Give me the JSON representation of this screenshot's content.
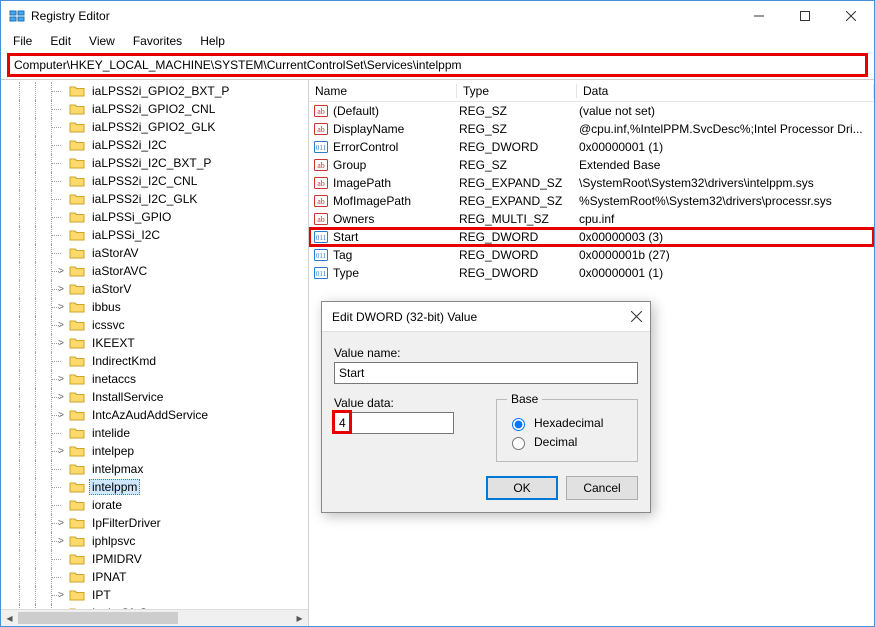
{
  "window": {
    "title": "Registry Editor"
  },
  "menu": {
    "file": "File",
    "edit": "Edit",
    "view": "View",
    "favorites": "Favorites",
    "help": "Help"
  },
  "address": "Computer\\HKEY_LOCAL_MACHINE\\SYSTEM\\CurrentControlSet\\Services\\intelppm",
  "tree": {
    "items": [
      {
        "label": "iaLPSS2i_GPIO2_BXT_P",
        "exp": ""
      },
      {
        "label": "iaLPSS2i_GPIO2_CNL",
        "exp": ""
      },
      {
        "label": "iaLPSS2i_GPIO2_GLK",
        "exp": ""
      },
      {
        "label": "iaLPSS2i_I2C",
        "exp": ""
      },
      {
        "label": "iaLPSS2i_I2C_BXT_P",
        "exp": ""
      },
      {
        "label": "iaLPSS2i_I2C_CNL",
        "exp": ""
      },
      {
        "label": "iaLPSS2i_I2C_GLK",
        "exp": ""
      },
      {
        "label": "iaLPSSi_GPIO",
        "exp": ""
      },
      {
        "label": "iaLPSSi_I2C",
        "exp": ""
      },
      {
        "label": "iaStorAV",
        "exp": ""
      },
      {
        "label": "iaStorAVC",
        "exp": ">"
      },
      {
        "label": "iaStorV",
        "exp": ">"
      },
      {
        "label": "ibbus",
        "exp": ">"
      },
      {
        "label": "icssvc",
        "exp": ">"
      },
      {
        "label": "IKEEXT",
        "exp": ">"
      },
      {
        "label": "IndirectKmd",
        "exp": ""
      },
      {
        "label": "inetaccs",
        "exp": ">"
      },
      {
        "label": "InstallService",
        "exp": ">"
      },
      {
        "label": "IntcAzAudAddService",
        "exp": ">"
      },
      {
        "label": "intelide",
        "exp": ""
      },
      {
        "label": "intelpep",
        "exp": ">"
      },
      {
        "label": "intelpmax",
        "exp": ""
      },
      {
        "label": "intelppm",
        "exp": "",
        "selected": true
      },
      {
        "label": "iorate",
        "exp": ""
      },
      {
        "label": "IpFilterDriver",
        "exp": ">"
      },
      {
        "label": "iphlpsvc",
        "exp": ">"
      },
      {
        "label": "IPMIDRV",
        "exp": ""
      },
      {
        "label": "IPNAT",
        "exp": ""
      },
      {
        "label": "IPT",
        "exp": ">"
      },
      {
        "label": "InvlatCfaSvc",
        "exp": ">"
      }
    ]
  },
  "list": {
    "headers": {
      "name": "Name",
      "type": "Type",
      "data": "Data"
    },
    "rows": [
      {
        "icon": "ab",
        "name": "(Default)",
        "type": "REG_SZ",
        "data": "(value not set)"
      },
      {
        "icon": "ab",
        "name": "DisplayName",
        "type": "REG_SZ",
        "data": "@cpu.inf,%IntelPPM.SvcDesc%;Intel Processor Dri..."
      },
      {
        "icon": "bin",
        "name": "ErrorControl",
        "type": "REG_DWORD",
        "data": "0x00000001 (1)"
      },
      {
        "icon": "ab",
        "name": "Group",
        "type": "REG_SZ",
        "data": "Extended Base"
      },
      {
        "icon": "ab",
        "name": "ImagePath",
        "type": "REG_EXPAND_SZ",
        "data": "\\SystemRoot\\System32\\drivers\\intelppm.sys"
      },
      {
        "icon": "ab",
        "name": "MofImagePath",
        "type": "REG_EXPAND_SZ",
        "data": "%SystemRoot%\\System32\\drivers\\processr.sys"
      },
      {
        "icon": "ab",
        "name": "Owners",
        "type": "REG_MULTI_SZ",
        "data": "cpu.inf"
      },
      {
        "icon": "bin",
        "name": "Start",
        "type": "REG_DWORD",
        "data": "0x00000003 (3)",
        "highlight": true
      },
      {
        "icon": "bin",
        "name": "Tag",
        "type": "REG_DWORD",
        "data": "0x0000001b (27)"
      },
      {
        "icon": "bin",
        "name": "Type",
        "type": "REG_DWORD",
        "data": "0x00000001 (1)"
      }
    ]
  },
  "dialog": {
    "title": "Edit DWORD (32-bit) Value",
    "value_name_label": "Value name:",
    "value_name": "Start",
    "value_data_label": "Value data:",
    "value_data": "4",
    "base_label": "Base",
    "hex_label": "Hexadecimal",
    "dec_label": "Decimal",
    "base_selected": "hex",
    "ok": "OK",
    "cancel": "Cancel"
  }
}
